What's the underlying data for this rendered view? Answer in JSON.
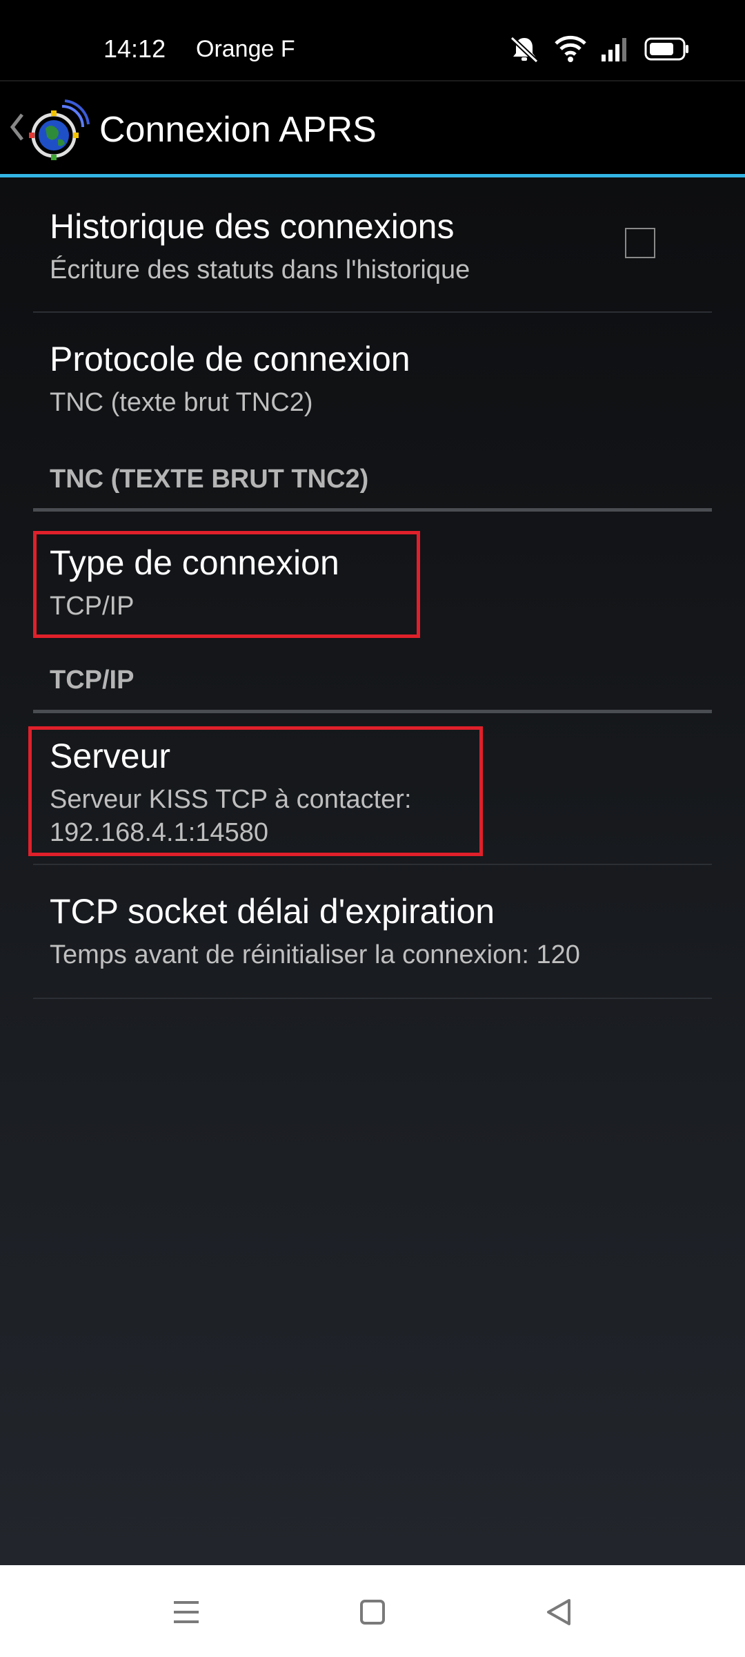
{
  "status_bar": {
    "time": "14:12",
    "carrier": "Orange F",
    "icons": [
      "mute-icon",
      "wifi-icon",
      "signal-icon",
      "battery-icon"
    ]
  },
  "action_bar": {
    "title": "Connexion APRS",
    "icon": "aprs-logo"
  },
  "colors": {
    "accent": "#33b5e5",
    "highlight": "#e0202a"
  },
  "preferences": {
    "history": {
      "title": "Historique des connexions",
      "summary": "Écriture des statuts dans l'historique",
      "checked": false
    },
    "protocol": {
      "title": "Protocole de connexion",
      "summary": "TNC (texte brut TNC2)"
    },
    "category_tnc": "TNC (TEXTE BRUT TNC2)",
    "connection_type": {
      "title": "Type de connexion",
      "summary": "TCP/IP"
    },
    "category_tcpip": "TCP/IP",
    "server": {
      "title": "Serveur",
      "summary_line1": "Serveur KISS TCP à contacter:",
      "summary_line2": "192.168.4.1:14580"
    },
    "timeout": {
      "title": "TCP socket délai d'expiration",
      "summary": "Temps avant de réinitialiser la connexion: 120"
    }
  },
  "nav_bar": {
    "buttons": [
      "menu-icon",
      "home-icon",
      "back-icon"
    ]
  }
}
